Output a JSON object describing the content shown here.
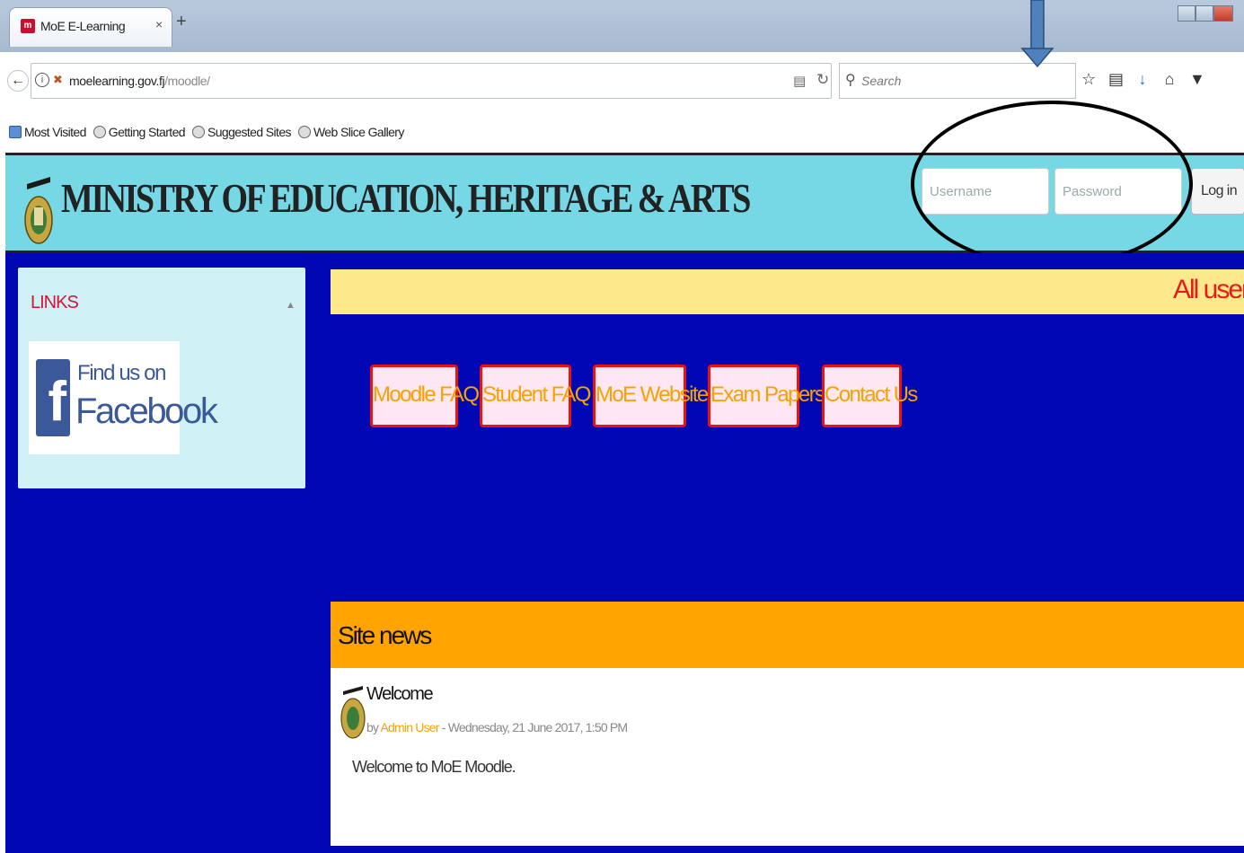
{
  "browser": {
    "tab_title": "MoE E-Learning",
    "tab_close": "×",
    "new_tab": "+",
    "url_host": "moelearning.gov.fj",
    "url_path": "/moodle/",
    "search_placeholder": "Search",
    "bookmarks": [
      "Most Visited",
      "Getting Started",
      "Suggested Sites",
      "Web Slice Gallery"
    ]
  },
  "header": {
    "site_title": "MINISTRY OF EDUCATION, HERITAGE & ARTS",
    "username_placeholder": "Username",
    "password_placeholder": "Password",
    "login_label": "Log in"
  },
  "sidebar": {
    "links_title": "LINKS",
    "facebook_find": "Find us on",
    "facebook_name": "Facebook"
  },
  "main": {
    "notice": "All users",
    "nav_buttons": [
      "Moodle FAQ",
      "Student FAQ",
      "MoE Website",
      "Exam Papers",
      "Contact Us"
    ],
    "site_news_title": "Site news",
    "news": {
      "title": "Welcome",
      "by": "by",
      "author": "Admin User",
      "date": "- Wednesday, 21 June 2017, 1:50 PM",
      "body": "Welcome to MoE Moodle."
    }
  },
  "colors": {
    "header_bg": "#76d7e5",
    "page_bg": "#0008b4",
    "notice_bg": "#fde98b",
    "site_news_bg": "#ffa400",
    "button_text": "#f5a300",
    "button_border": "#e11111"
  }
}
